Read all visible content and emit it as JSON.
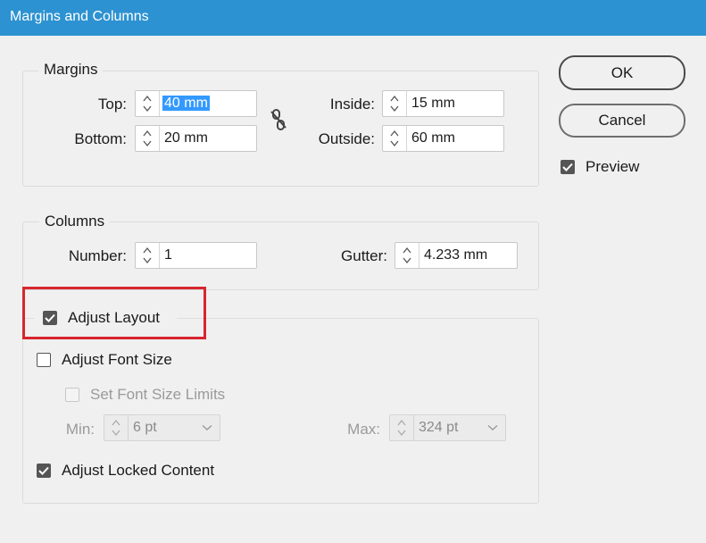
{
  "window": {
    "title": "Margins and Columns"
  },
  "margins": {
    "group_label": "Margins",
    "top": {
      "label": "Top:",
      "value": "40 mm"
    },
    "bottom": {
      "label": "Bottom:",
      "value": "20 mm"
    },
    "inside": {
      "label": "Inside:",
      "value": "15 mm"
    },
    "outside": {
      "label": "Outside:",
      "value": "60 mm"
    },
    "link_icon": "chain-link-broken-icon"
  },
  "columns": {
    "group_label": "Columns",
    "number": {
      "label": "Number:",
      "value": "1"
    },
    "gutter": {
      "label": "Gutter:",
      "value": "4.233 mm"
    }
  },
  "adjust": {
    "adjust_layout": {
      "label": "Adjust Layout",
      "checked": true
    },
    "adjust_font_size": {
      "label": "Adjust Font Size",
      "checked": false
    },
    "set_font_size_limits": {
      "label": "Set Font Size Limits",
      "checked": false,
      "enabled": false
    },
    "min": {
      "label": "Min:",
      "value": "6 pt"
    },
    "max": {
      "label": "Max:",
      "value": "324 pt"
    },
    "adjust_locked_content": {
      "label": "Adjust Locked Content",
      "checked": true
    }
  },
  "buttons": {
    "ok": "OK",
    "cancel": "Cancel"
  },
  "preview": {
    "label": "Preview",
    "checked": true
  },
  "colors": {
    "titlebar": "#2d92d1",
    "highlight": "#d7262e",
    "selection": "#3399ff"
  }
}
